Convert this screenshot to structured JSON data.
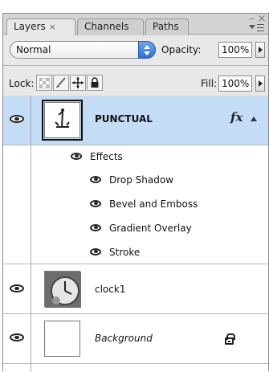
{
  "tabs": [
    {
      "label": "Layers",
      "close": "×",
      "active": true
    },
    {
      "label": "Channels",
      "active": false
    },
    {
      "label": "Paths",
      "active": false
    }
  ],
  "panel_controls": {
    "close": "– ×"
  },
  "blend_mode": {
    "value": "Normal"
  },
  "opacity": {
    "label": "Opacity:",
    "value": "100%"
  },
  "lock": {
    "label": "Lock:"
  },
  "fill": {
    "label": "Fill:",
    "value": "100%"
  },
  "layers": [
    {
      "name": "PUNCTUAL",
      "selected": true,
      "fx": "fx",
      "effects_label": "Effects",
      "effects": [
        "Drop Shadow",
        "Bevel and Emboss",
        "Gradient Overlay",
        "Stroke"
      ]
    },
    {
      "name": "clock1",
      "selected": false
    },
    {
      "name": "Background",
      "selected": false,
      "locked": true
    }
  ],
  "colors": {
    "selection": "#c5dcf6",
    "panel": "#e8e8e8",
    "accent": "#2f6fd2"
  }
}
